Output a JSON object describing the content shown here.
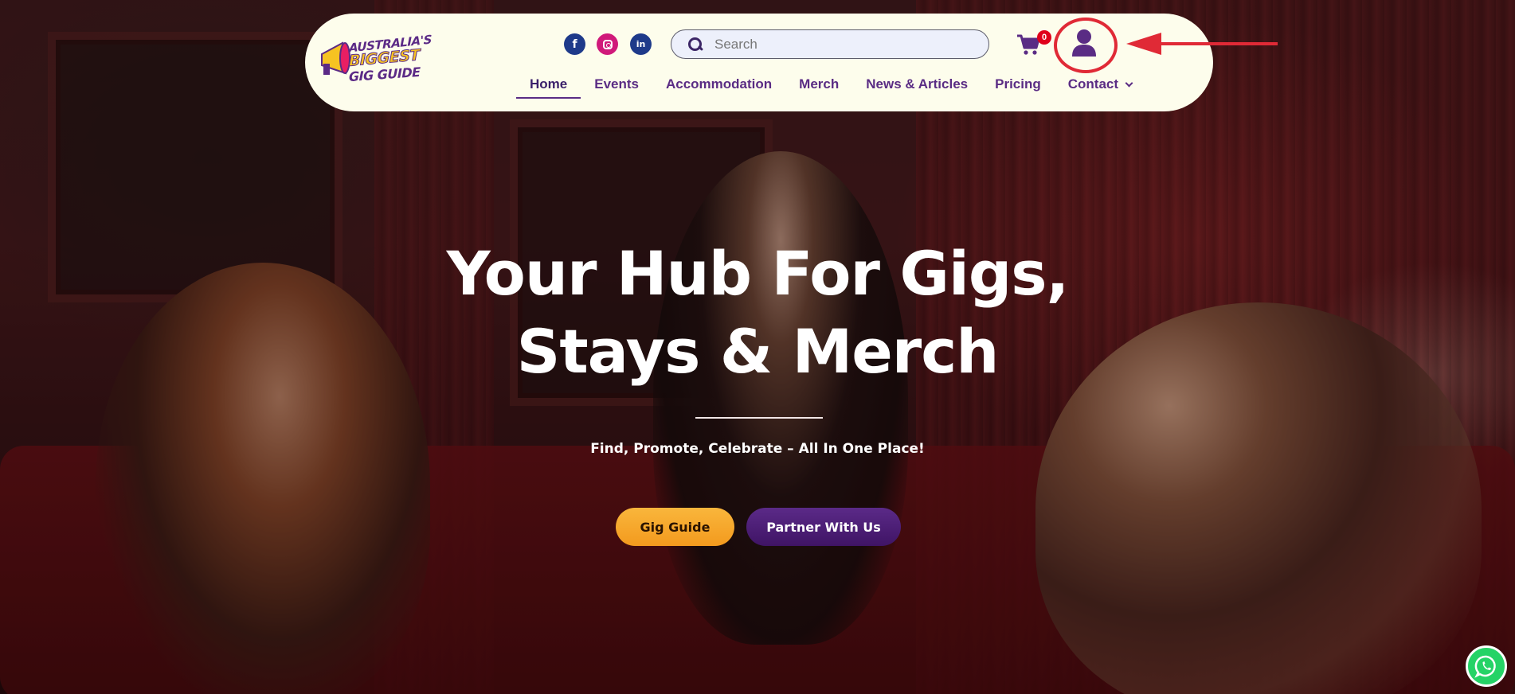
{
  "logo": {
    "line1": "AUSTRALIA'S",
    "line2": "BIGGEST",
    "line3": "GIG GUIDE"
  },
  "search": {
    "placeholder": "Search"
  },
  "cart": {
    "count": "0"
  },
  "nav": {
    "items": [
      {
        "label": "Home"
      },
      {
        "label": "Events"
      },
      {
        "label": "Accommodation"
      },
      {
        "label": "Merch"
      },
      {
        "label": "News & Articles"
      },
      {
        "label": "Pricing"
      },
      {
        "label": "Contact"
      }
    ]
  },
  "hero": {
    "headline_line1": "Your Hub For Gigs,",
    "headline_line2": "Stays & Merch",
    "subline": "Find, Promote, Celebrate – All In One Place!",
    "primary_button": "Gig Guide",
    "secondary_button": "Partner With Us"
  },
  "colors": {
    "brand_purple": "#5a2c84",
    "brand_orange": "#f5a623",
    "nav_background": "#fdfdec",
    "highlight_red": "#e02a36"
  },
  "icons": {
    "facebook": "facebook-icon",
    "instagram": "instagram-icon",
    "linkedin": "linkedin-icon",
    "search": "search-icon",
    "cart": "cart-icon",
    "user": "user-icon",
    "whatsapp": "whatsapp-icon",
    "chevron": "chevron-down-icon"
  }
}
